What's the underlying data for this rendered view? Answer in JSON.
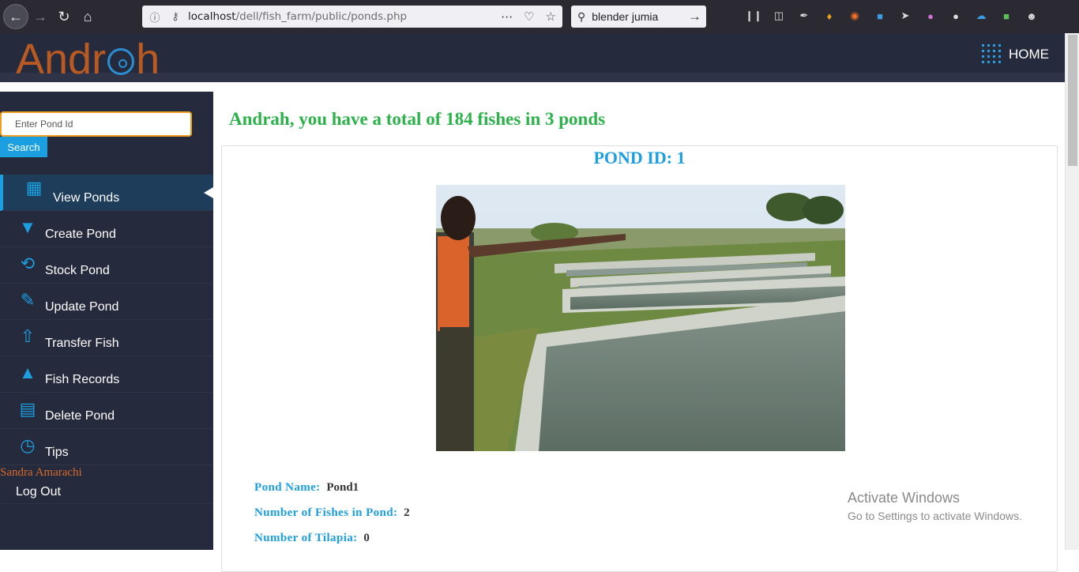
{
  "browser": {
    "url_host": "localhost",
    "url_path": "/dell/fish_farm/public/ponds.php",
    "search_text": "blender jumia"
  },
  "header": {
    "logo": "Andrah",
    "home_label": "HOME"
  },
  "sidebar": {
    "search_placeholder": "Enter Pond Id",
    "search_button": "Search",
    "items": [
      {
        "label": "View Ponds",
        "icon": "grid-icon"
      },
      {
        "label": "Create Pond",
        "icon": "basket-icon"
      },
      {
        "label": "Stock Pond",
        "icon": "refresh-icon"
      },
      {
        "label": "Update Pond",
        "icon": "pencil-icon"
      },
      {
        "label": "Transfer Fish",
        "icon": "transfer-basket-icon"
      },
      {
        "label": "Fish Records",
        "icon": "flask-icon"
      },
      {
        "label": "Delete Pond",
        "icon": "archive-icon"
      },
      {
        "label": "Tips",
        "icon": "clock-icon"
      }
    ],
    "user_name": "Sandra Amarachi",
    "logout": "Log Out"
  },
  "main": {
    "headline": "Andrah, you have a total of 184 fishes in 3 ponds",
    "pond_title": "POND ID: 1",
    "details": {
      "name_label": "Pond Name:",
      "name_value": "Pond1",
      "fishes_label": "Number of Fishes in Pond:",
      "fishes_value": "2",
      "tilapia_label": "Number of Tilapia:",
      "tilapia_value": "0"
    }
  },
  "watermark": {
    "line1": "Activate Windows",
    "line2": "Go to Settings to activate Windows."
  }
}
